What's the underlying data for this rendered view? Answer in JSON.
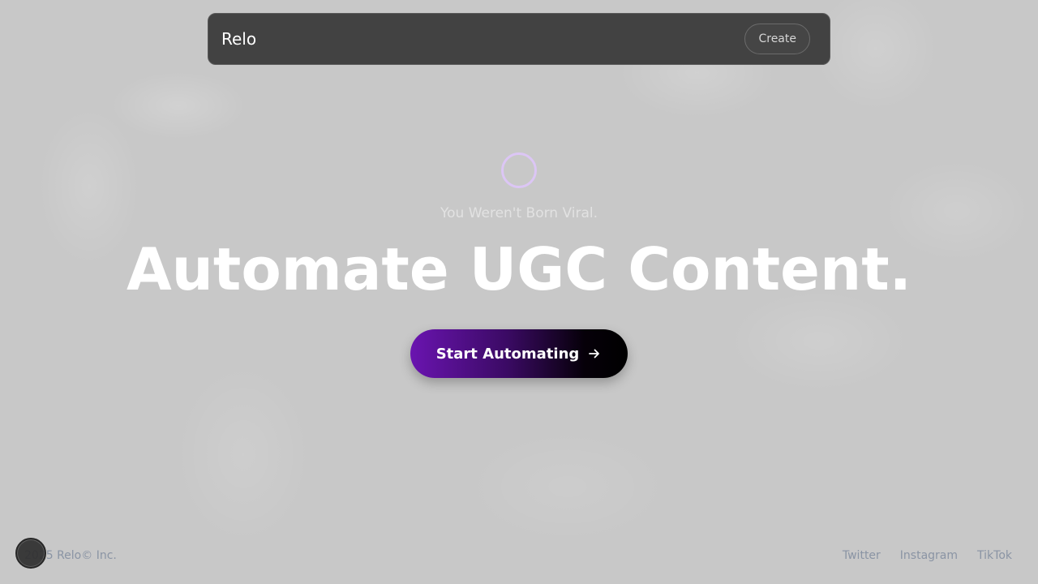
{
  "nav": {
    "brand": "Relo",
    "create_label": "Create"
  },
  "hero": {
    "kicker": "You Weren't Born Viral.",
    "headline": "Automate UGC Content.",
    "cta_label": "Start Automating"
  },
  "footer": {
    "copyright": "2025 Relo© Inc.",
    "links": [
      "Twitter",
      "Instagram",
      "TikTok"
    ]
  },
  "icons": {
    "cta": "arrow-right-icon",
    "loading": "loading-spinner-icon",
    "badge": "floating-action-badge"
  },
  "colors": {
    "background": "#c8c8c8",
    "nav_bg": "#424242",
    "cta_start": "#6a14b0",
    "cta_end": "#000000",
    "spinner": "#dcc6f5",
    "footer_text": "#8a94a4"
  }
}
